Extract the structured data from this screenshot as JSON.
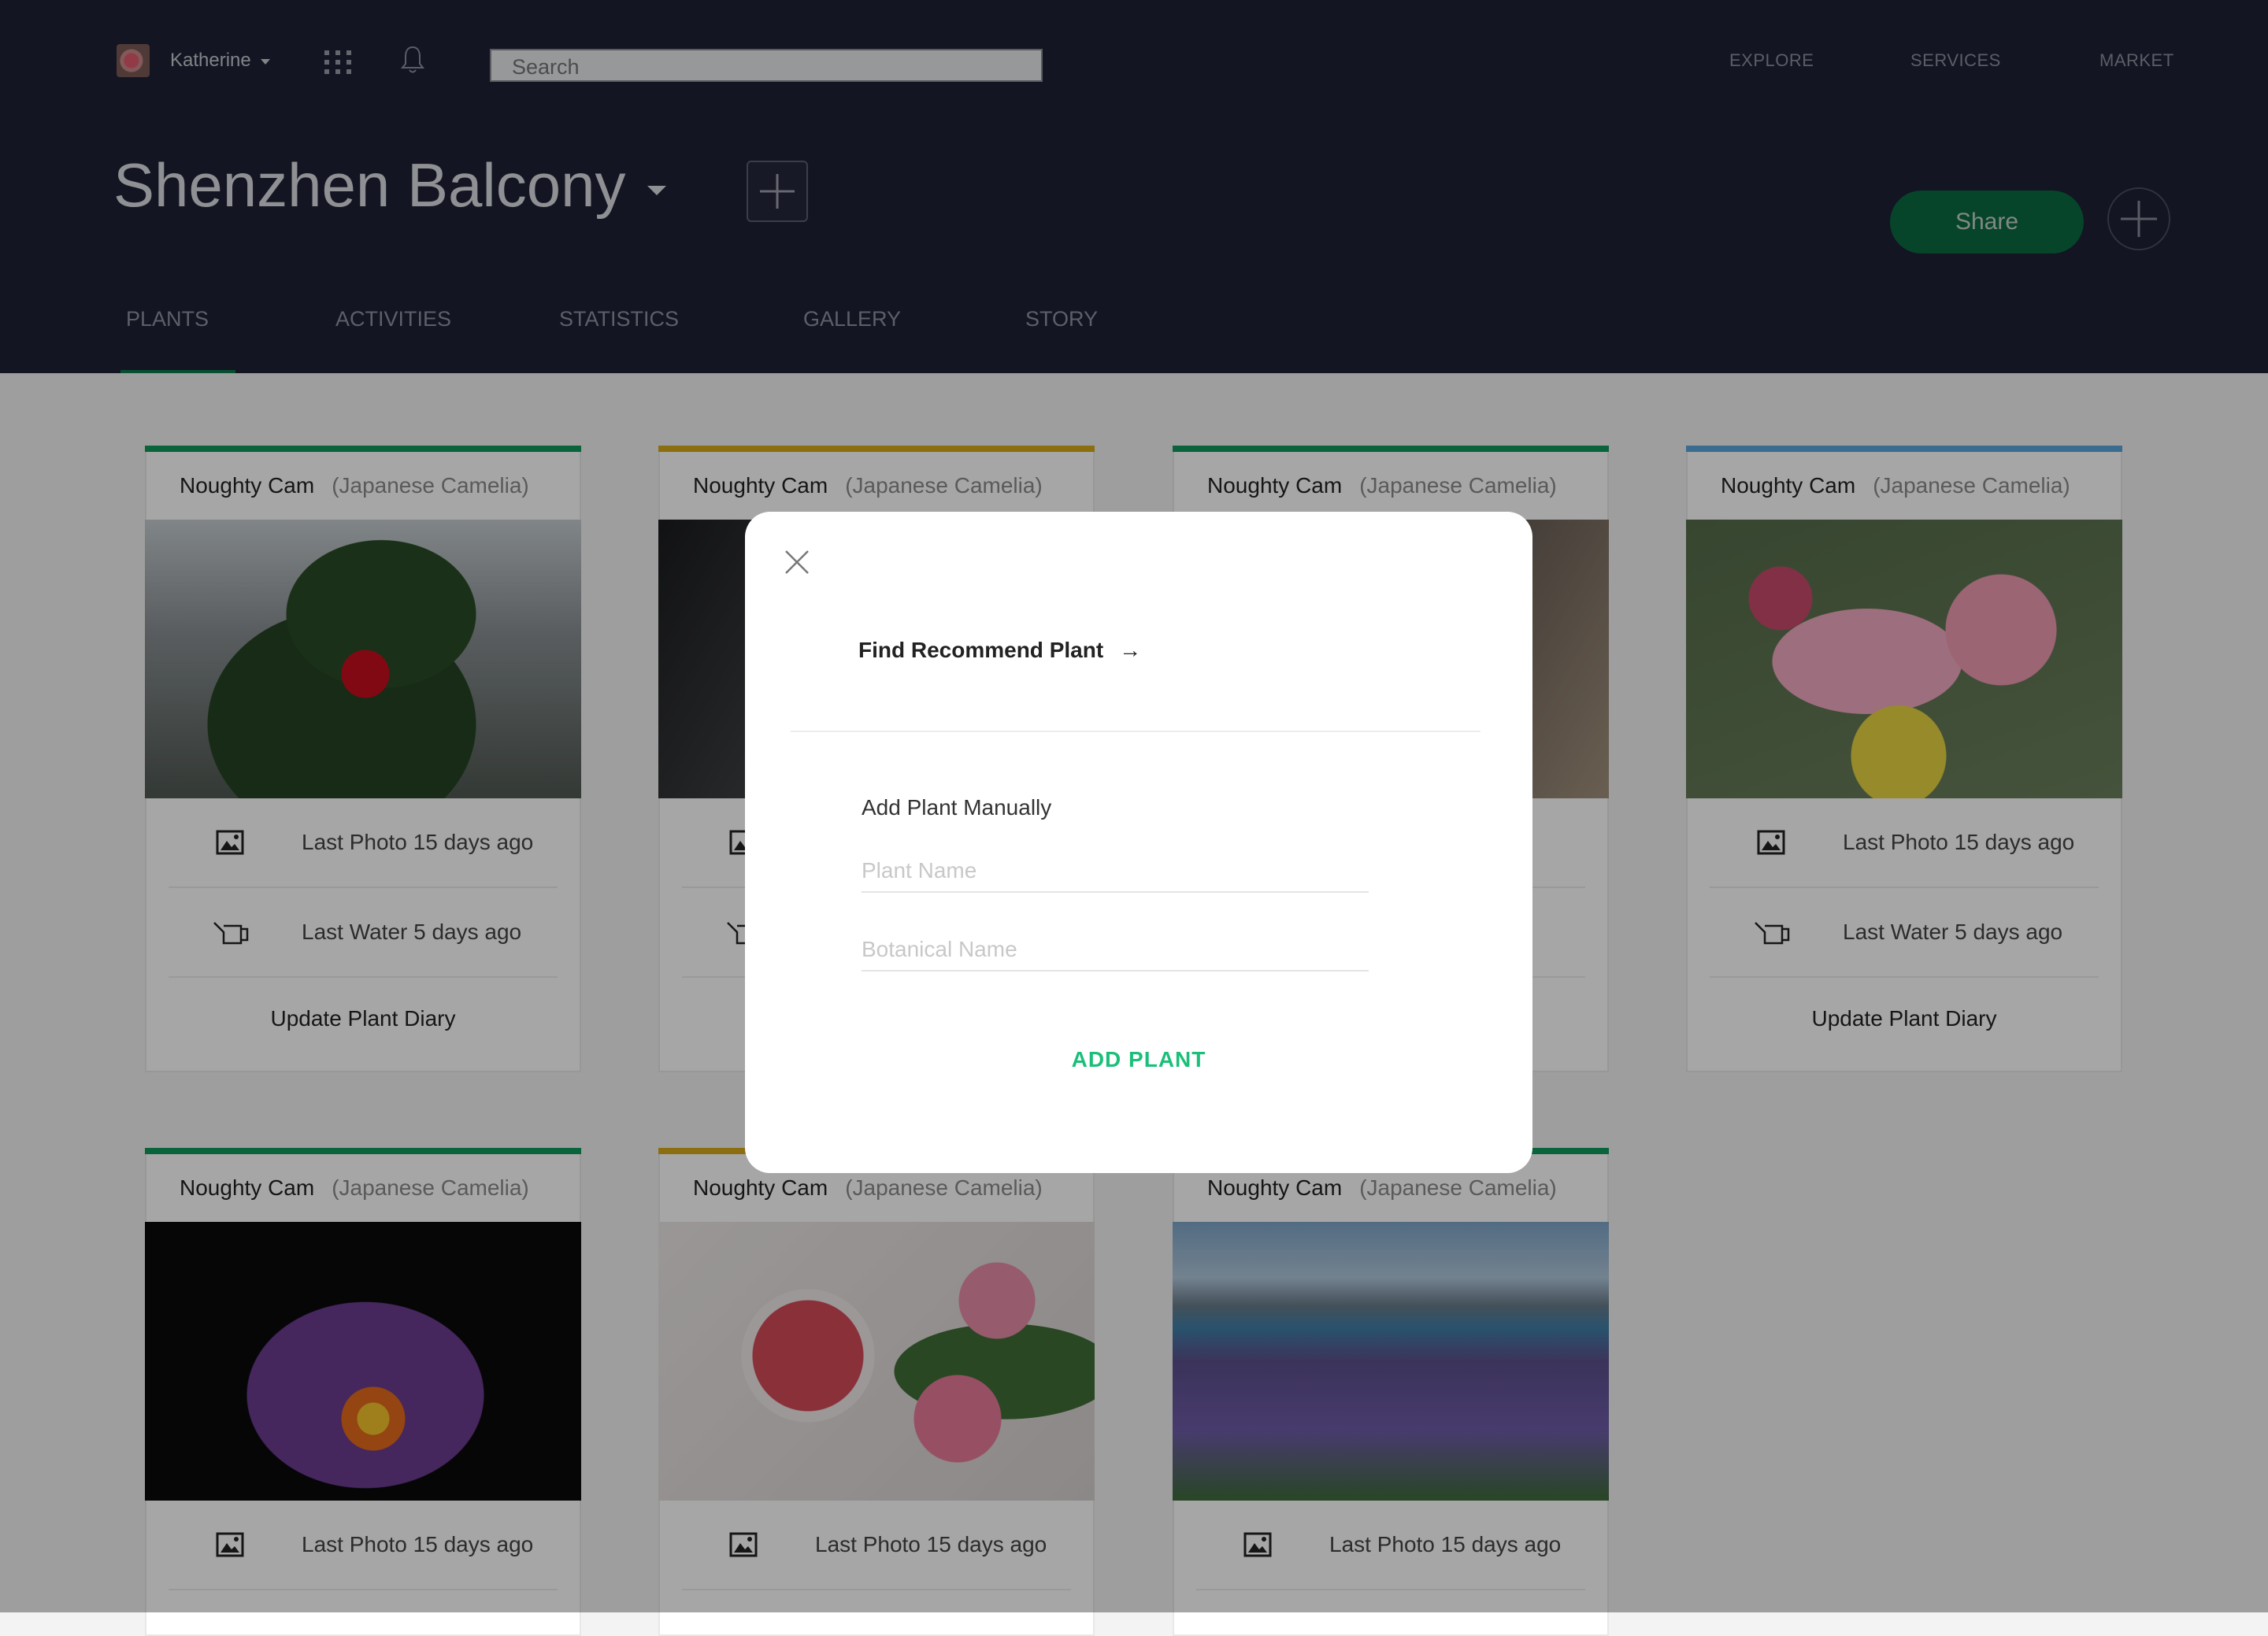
{
  "header": {
    "user": {
      "name": "Katherine"
    },
    "search": {
      "placeholder": "Search"
    },
    "nav": [
      "EXPLORE",
      "SERVICES",
      "MARKET"
    ],
    "title": "Shenzhen Balcony",
    "share_label": "Share",
    "tabs": [
      "PLANTS",
      "ACTIVITIES",
      "STATISTICS",
      "GALLERY",
      "STORY"
    ],
    "active_tab": "PLANTS"
  },
  "colors": {
    "green": "#0f9a5c",
    "yellow": "#d4aa1a",
    "blue": "#5aa6dc",
    "accent": "#1bbf79"
  },
  "cards": [
    {
      "name": "Noughty Cam",
      "botanical": "(Japanese Camelia)",
      "status_color": "#0f9a5c",
      "photo_label": "Last Photo 15 days ago",
      "water_label": "Last Water 5 days ago",
      "action": "Update Plant Diary"
    },
    {
      "name": "Noughty Cam",
      "botanical": "(Japanese Camelia)",
      "status_color": "#d4aa1a"
    },
    {
      "name": "Noughty Cam",
      "botanical": "(Japanese Camelia)",
      "status_color": "#0f9a5c"
    },
    {
      "name": "Noughty Cam",
      "botanical": "(Japanese Camelia)",
      "status_color": "#5aa6dc",
      "photo_label": "Last Photo 15 days ago",
      "water_label": "Last Water 5 days ago",
      "action": "Update Plant Diary"
    },
    {
      "name": "Noughty Cam",
      "botanical": "(Japanese Camelia)",
      "status_color": "#0f9a5c",
      "photo_label": "Last Photo 15 days ago"
    },
    {
      "name": "Noughty Cam",
      "botanical": "(Japanese Camelia)",
      "status_color": "#d4aa1a",
      "photo_label": "Last Photo 15 days ago"
    },
    {
      "name": "Noughty Cam",
      "botanical": "(Japanese Camelia)",
      "status_color": "#0f9a5c",
      "photo_label": "Last Photo 15 days ago"
    }
  ],
  "modal": {
    "find_link": "Find Recommend Plant",
    "manual_label": "Add Plant Manually",
    "plant_name_placeholder": "Plant Name",
    "botanical_name_placeholder": "Botanical Name",
    "add_button": "ADD PLANT"
  },
  "icons": {
    "close": "close-icon",
    "arrow": "arrow-right-icon",
    "photo": "image-icon",
    "water": "watering-can-icon"
  }
}
